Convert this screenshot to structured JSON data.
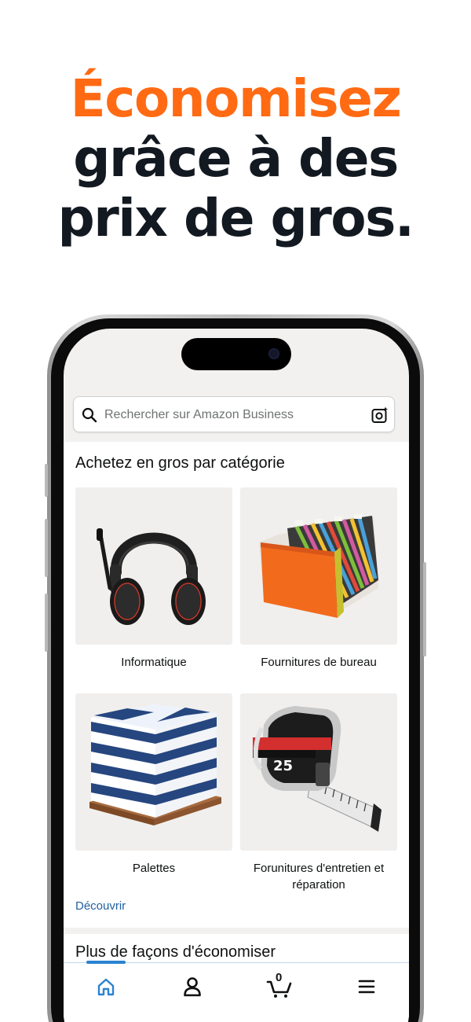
{
  "headline": {
    "line1": "Économisez",
    "line2": "grâce à des",
    "line3": "prix de gros."
  },
  "search": {
    "placeholder": "Rechercher sur Amazon Business",
    "search_icon": "search-icon",
    "camera_icon": "camera-search-icon"
  },
  "categories_section": {
    "title": "Achetez en gros par catégorie",
    "items": [
      {
        "label": "Informatique",
        "image": "headset"
      },
      {
        "label": "Fournitures de bureau",
        "image": "hanging-file-folders"
      },
      {
        "label": "Palettes",
        "image": "paper-pallet"
      },
      {
        "label": "Forunitures d'entretien et réparation",
        "image": "tape-measure"
      }
    ],
    "link": "Découvrir"
  },
  "savings_section": {
    "title": "Plus de façons d'économiser"
  },
  "tabbar": {
    "items": [
      {
        "name": "home",
        "icon": "home-icon",
        "active": true
      },
      {
        "name": "account",
        "icon": "user-icon",
        "active": false
      },
      {
        "name": "cart",
        "icon": "cart-icon",
        "active": false,
        "count": "0"
      },
      {
        "name": "menu",
        "icon": "menu-icon",
        "active": false
      }
    ]
  },
  "colors": {
    "accent_orange": "#ff6a13",
    "headline_dark": "#131921",
    "link_blue": "#2162a1",
    "active_tab_blue": "#2a83d1"
  }
}
